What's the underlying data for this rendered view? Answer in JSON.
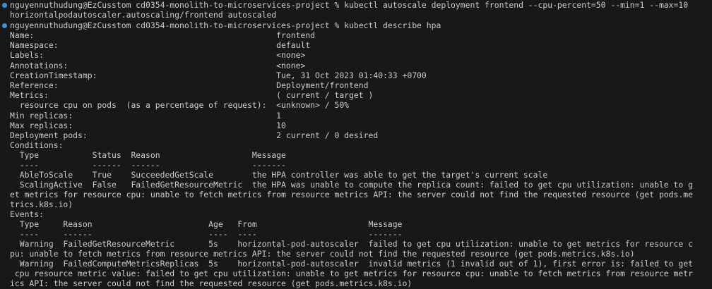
{
  "colors": {
    "background": "#181818",
    "foreground": "#cccccc",
    "prompt_dot": "#3f8fdc"
  },
  "icons": {
    "prompt_marker": "blue-dot-icon"
  },
  "lines": [
    "nguyennuthudung@EzCusstom cd0354-monolith-to-microservices-project % kubectl autoscale deployment frontend --cpu-percent=50 --min=1 --max=10",
    "horizontalpodautoscaler.autoscaling/frontend autoscaled",
    "nguyennuthudung@EzCusstom cd0354-monolith-to-microservices-project % kubectl describe hpa",
    "Name:                                                  frontend",
    "Namespace:                                             default",
    "Labels:                                                <none>",
    "Annotations:                                           <none>",
    "CreationTimestamp:                                     Tue, 31 Oct 2023 01:40:33 +0700",
    "Reference:                                             Deployment/frontend",
    "Metrics:                                               ( current / target )",
    "  resource cpu on pods  (as a percentage of request):  <unknown> / 50%",
    "Min replicas:                                          1",
    "Max replicas:                                          10",
    "Deployment pods:                                       2 current / 0 desired",
    "Conditions:",
    "  Type           Status  Reason                   Message",
    "  ----           ------  ------                   -------",
    "  AbleToScale    True    SucceededGetScale        the HPA controller was able to get the target's current scale",
    "  ScalingActive  False   FailedGetResourceMetric  the HPA was unable to compute the replica count: failed to get cpu utilization: unable to g",
    "et metrics for resource cpu: unable to fetch metrics from resource metrics API: the server could not find the requested resource (get pods.me",
    "trics.k8s.io)",
    "Events:",
    "  Type     Reason                        Age   From                       Message",
    "  ----     ------                        ----  ----                       -------",
    "  Warning  FailedGetResourceMetric       5s    horizontal-pod-autoscaler  failed to get cpu utilization: unable to get metrics for resource c",
    "pu: unable to fetch metrics from resource metrics API: the server could not find the requested resource (get pods.metrics.k8s.io)",
    "  Warning  FailedComputeMetricsReplicas  5s    horizontal-pod-autoscaler  invalid metrics (1 invalid out of 1), first error is: failed to get",
    " cpu resource metric value: failed to get cpu utilization: unable to get metrics for resource cpu: unable to fetch metrics from resource metr",
    "ics API: the server could not find the requested resource (get pods.metrics.k8s.io)"
  ]
}
